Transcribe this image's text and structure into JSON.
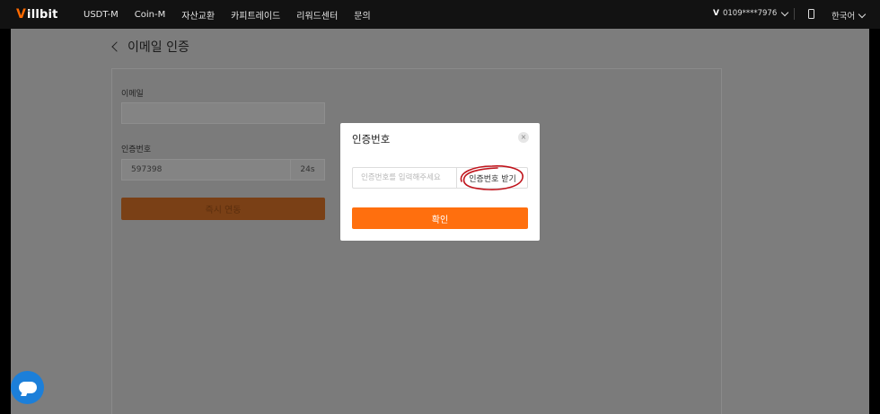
{
  "header": {
    "logo_text": "illbit",
    "logo_mark": "V",
    "nav": [
      "USDT-M",
      "Coin-M",
      "자산교환",
      "카피트레이드",
      "리워드센터",
      "문의"
    ],
    "account_icon": "V",
    "account_id": "0109****7976",
    "language": "한국어"
  },
  "page": {
    "title": "이메일 인증",
    "email_label": "이메일",
    "email_value": "",
    "code_label": "인증번호",
    "code_value": "597398",
    "timer": "24s",
    "link_button": "즉시 연동"
  },
  "modal": {
    "title": "인증번호",
    "close_icon": "×",
    "code_placeholder": "인증번호를 입력해주세요",
    "get_code": "인증번호 받기",
    "confirm": "확인",
    "annotation_color": "#c0141c"
  },
  "colors": {
    "accent": "#ff6f0e",
    "chat": "#1c7fd9"
  }
}
